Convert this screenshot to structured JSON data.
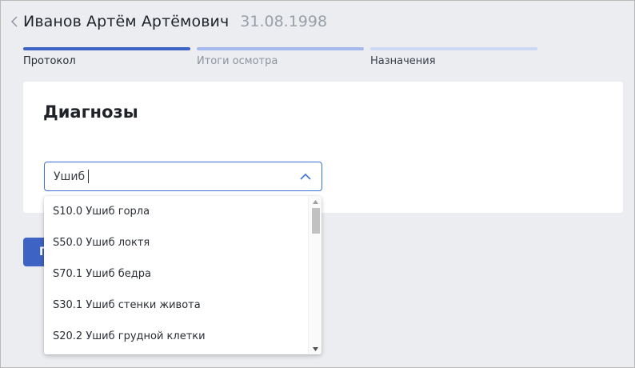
{
  "header": {
    "patient_name": "Иванов Артём Артёмович",
    "birth_date": "31.08.1998"
  },
  "steps": [
    {
      "label": "Протокол",
      "state": "active"
    },
    {
      "label": "Итоги осмотра",
      "state": "pending"
    },
    {
      "label": "Назначения",
      "state": "pending"
    }
  ],
  "diagnoses": {
    "title": "Диагнозы",
    "search_value": "Ушиб",
    "options": [
      "S10.0 Ушиб горла",
      "S50.0 Ушиб локтя",
      "S70.1 Ушиб бедра",
      "S30.1 Ушиб стенки живота",
      "S20.2 Ушиб грудной клетки"
    ]
  },
  "primary_button": {
    "label": "П"
  },
  "colors": {
    "accent": "#3d63c5",
    "focus_border": "#3d73d6",
    "background": "#ebedf0"
  }
}
